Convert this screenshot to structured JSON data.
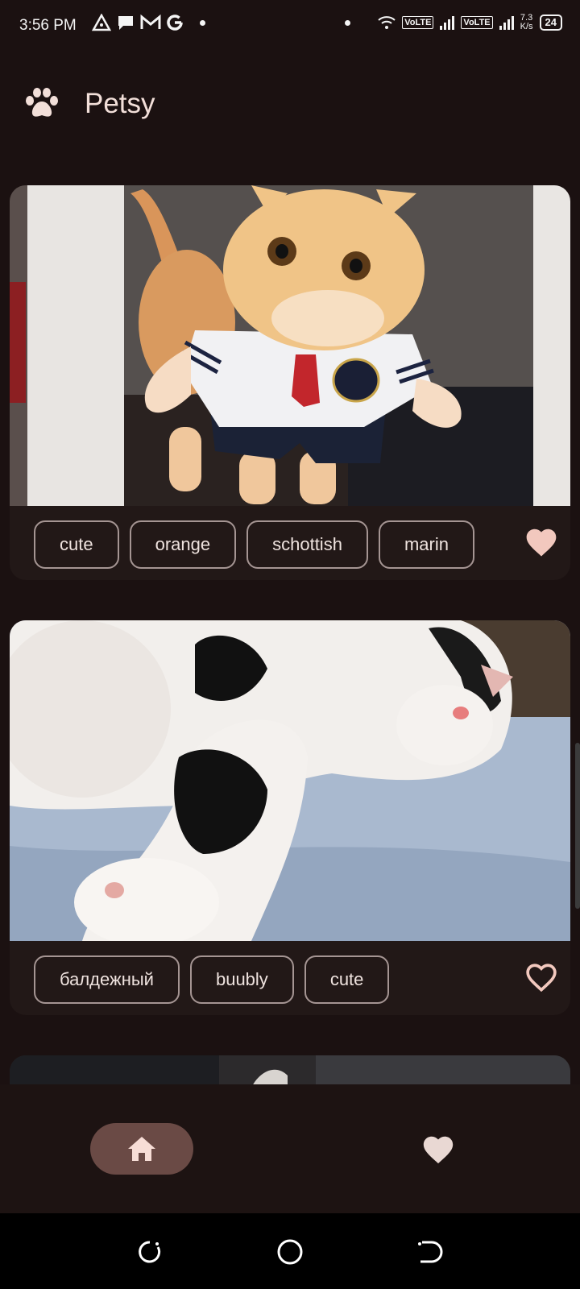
{
  "status_bar": {
    "time": "3:56 PM",
    "net_speed_value": "7.3",
    "net_speed_unit": "K/s",
    "battery": "24",
    "sim1": "VoLTE",
    "sim2": "VoLTE"
  },
  "app": {
    "title": "Petsy",
    "logo_icon": "paw-icon"
  },
  "posts": [
    {
      "tags": [
        "cute",
        "orange",
        "schottish",
        "marin"
      ],
      "liked": true,
      "photo_subject": "cat-in-sailor-costume"
    },
    {
      "tags": [
        "балдежный",
        "buubly",
        "cute"
      ],
      "liked": false,
      "photo_subject": "sleeping-white-black-cat"
    }
  ],
  "bottom_nav": {
    "items": [
      {
        "icon": "home-icon",
        "selected": true
      },
      {
        "icon": "heart-icon",
        "selected": false
      }
    ]
  },
  "colors": {
    "background": "#1b1111",
    "accent": "#f2c8be",
    "nav_selected": "#6a4a45",
    "tag_border": "#a59593"
  }
}
